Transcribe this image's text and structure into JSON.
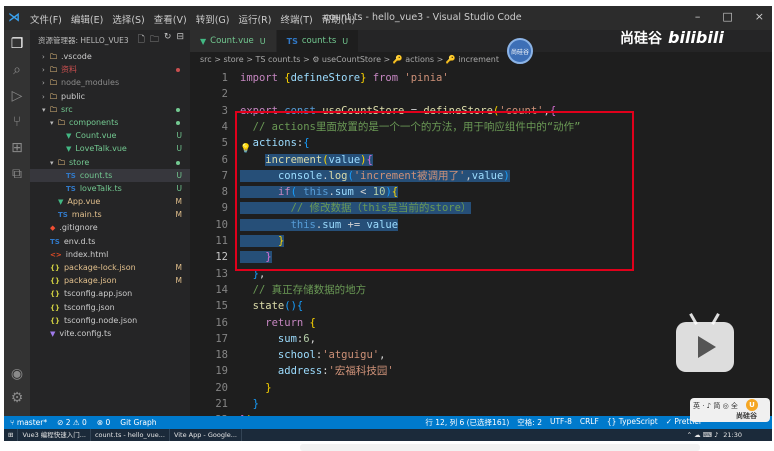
{
  "window": {
    "title": "count.ts - hello_vue3 - Visual Studio Code",
    "menus": [
      "文件(F)",
      "编辑(E)",
      "选择(S)",
      "查看(V)",
      "转到(G)",
      "运行(R)",
      "终端(T)",
      "帮助(H)"
    ],
    "controls": [
      "–",
      "□",
      "×"
    ]
  },
  "sidebar": {
    "header": "资源管理器: HELLO_VUE3",
    "items": [
      {
        "indent": 1,
        "chev": ">",
        "icon": "folder",
        "label": ".vscode",
        "color": "#cccccc",
        "mark": "",
        "dot": ""
      },
      {
        "indent": 1,
        "chev": ">",
        "icon": "folder",
        "label": "资料",
        "color": "#c94f4f",
        "mark": "",
        "dot": "#c94f4f"
      },
      {
        "indent": 1,
        "chev": ">",
        "icon": "folder",
        "label": "node_modules",
        "color": "#8b8b8b",
        "mark": "",
        "dot": ""
      },
      {
        "indent": 1,
        "chev": ">",
        "icon": "folder",
        "label": "public",
        "color": "#cccccc",
        "mark": "",
        "dot": ""
      },
      {
        "indent": 1,
        "chev": "v",
        "icon": "folder",
        "label": "src",
        "color": "#73c991",
        "mark": "",
        "dot": "#73c991"
      },
      {
        "indent": 2,
        "chev": "v",
        "icon": "folder",
        "label": "components",
        "color": "#73c991",
        "mark": "",
        "dot": "#73c991"
      },
      {
        "indent": 3,
        "chev": "",
        "icon": "vue",
        "label": "Count.vue",
        "color": "#73c991",
        "mark": "U",
        "dot": ""
      },
      {
        "indent": 3,
        "chev": "",
        "icon": "vue",
        "label": "LoveTalk.vue",
        "color": "#73c991",
        "mark": "U",
        "dot": ""
      },
      {
        "indent": 2,
        "chev": "v",
        "icon": "folder",
        "label": "store",
        "color": "#73c991",
        "mark": "",
        "dot": "#73c991"
      },
      {
        "indent": 3,
        "chev": "",
        "icon": "ts",
        "label": "count.ts",
        "color": "#73c991",
        "mark": "U",
        "dot": "",
        "selected": true
      },
      {
        "indent": 3,
        "chev": "",
        "icon": "ts",
        "label": "loveTalk.ts",
        "color": "#73c991",
        "mark": "U",
        "dot": ""
      },
      {
        "indent": 2,
        "chev": "",
        "icon": "vue",
        "label": "App.vue",
        "color": "#e2c08d",
        "mark": "M",
        "dot": ""
      },
      {
        "indent": 2,
        "chev": "",
        "icon": "ts",
        "label": "main.ts",
        "color": "#e2c08d",
        "mark": "M",
        "dot": ""
      },
      {
        "indent": 1,
        "chev": "",
        "icon": "git",
        "label": ".gitignore",
        "color": "#cccccc",
        "mark": "",
        "dot": ""
      },
      {
        "indent": 1,
        "chev": "",
        "icon": "ts",
        "label": "env.d.ts",
        "color": "#cccccc",
        "mark": "",
        "dot": ""
      },
      {
        "indent": 1,
        "chev": "",
        "icon": "html",
        "label": "index.html",
        "color": "#cccccc",
        "mark": "",
        "dot": ""
      },
      {
        "indent": 1,
        "chev": "",
        "icon": "json",
        "label": "package-lock.json",
        "color": "#e2c08d",
        "mark": "M",
        "dot": ""
      },
      {
        "indent": 1,
        "chev": "",
        "icon": "json",
        "label": "package.json",
        "color": "#e2c08d",
        "mark": "M",
        "dot": ""
      },
      {
        "indent": 1,
        "chev": "",
        "icon": "json",
        "label": "tsconfig.app.json",
        "color": "#cccccc",
        "mark": "",
        "dot": ""
      },
      {
        "indent": 1,
        "chev": "",
        "icon": "json",
        "label": "tsconfig.json",
        "color": "#cccccc",
        "mark": "",
        "dot": ""
      },
      {
        "indent": 1,
        "chev": "",
        "icon": "json",
        "label": "tsconfig.node.json",
        "color": "#cccccc",
        "mark": "",
        "dot": ""
      },
      {
        "indent": 1,
        "chev": "",
        "icon": "vite",
        "label": "vite.config.ts",
        "color": "#cccccc",
        "mark": "",
        "dot": ""
      }
    ]
  },
  "tabs": [
    {
      "label": "Count.vue",
      "icon": "vue",
      "mark": "U",
      "active": false
    },
    {
      "label": "count.ts",
      "icon": "ts",
      "mark": "U",
      "active": true
    }
  ],
  "breadcrumb": "src > store > TS count.ts > ⚙ useCountStore > 🔑 actions > 🔑 increment",
  "code": {
    "first_line": 1,
    "current_line": 12,
    "lines": [
      [
        [
          "kw2",
          "import "
        ],
        [
          "br",
          "{"
        ],
        [
          "var",
          "defineStore"
        ],
        [
          "br",
          "}"
        ],
        [
          "kw2",
          " from "
        ],
        [
          "str",
          "'pinia'"
        ]
      ],
      [],
      [
        [
          "kw2",
          "export "
        ],
        [
          "kw",
          "const "
        ],
        [
          "fn",
          "useCountStore"
        ],
        [
          "d",
          " = "
        ],
        [
          "fn",
          "defineStore"
        ],
        [
          "br",
          "("
        ],
        [
          "str",
          "'count'"
        ],
        [
          "d",
          ","
        ],
        [
          "br2",
          "{"
        ]
      ],
      [
        [
          "cm",
          "  // actions里面放置的是一个一个的方法，用于响应组件中的“动作”"
        ]
      ],
      [
        [
          "var",
          "  actions"
        ],
        [
          "d",
          ":"
        ],
        [
          "br3",
          "{"
        ]
      ],
      [
        [
          "d",
          "    "
        ],
        [
          "fn",
          "increment",
          "hl"
        ],
        [
          "br",
          "(",
          "hl"
        ],
        [
          "var",
          "value",
          "hl"
        ],
        [
          "br",
          ")",
          "hl"
        ],
        [
          "br2",
          "{",
          "hl"
        ]
      ],
      [
        [
          "d",
          "      ",
          "hl"
        ],
        [
          "var",
          "console",
          "hl"
        ],
        [
          "d",
          ".",
          "hl"
        ],
        [
          "fn",
          "log",
          "hl"
        ],
        [
          "br3",
          "(",
          "hl"
        ],
        [
          "str",
          "'increment被调用了'",
          "hl"
        ],
        [
          "d",
          ",",
          "hl"
        ],
        [
          "var",
          "value",
          "hl"
        ],
        [
          "br3",
          ")",
          "hl"
        ]
      ],
      [
        [
          "d",
          "      ",
          "hl"
        ],
        [
          "kw2",
          "if",
          "hl"
        ],
        [
          "br3",
          "(",
          "hl"
        ],
        [
          "kw",
          " this",
          "hl"
        ],
        [
          "d",
          ".",
          "hl"
        ],
        [
          "var",
          "sum",
          "hl"
        ],
        [
          "d",
          " < ",
          "hl"
        ],
        [
          "num",
          "10",
          "hl"
        ],
        [
          "br3",
          ")",
          "hl"
        ],
        [
          "br",
          "{",
          "hl"
        ]
      ],
      [
        [
          "d",
          "        ",
          "hl"
        ],
        [
          "cm",
          "// 修改数据（this是当前的store）",
          "hl"
        ]
      ],
      [
        [
          "d",
          "        ",
          "hl"
        ],
        [
          "kw",
          "this",
          "hl"
        ],
        [
          "d",
          ".",
          "hl"
        ],
        [
          "var",
          "sum",
          "hl"
        ],
        [
          "d",
          " += ",
          "hl"
        ],
        [
          "var",
          "value",
          "hl"
        ]
      ],
      [
        [
          "d",
          "      ",
          "hl"
        ],
        [
          "br",
          "}",
          "hl"
        ]
      ],
      [
        [
          "d",
          "    ",
          "hl"
        ],
        [
          "br2",
          "}",
          "hl"
        ]
      ],
      [
        [
          "br3",
          "  }"
        ],
        [
          "d",
          ","
        ]
      ],
      [
        [
          "cm",
          "  // 真正存储数据的地方"
        ]
      ],
      [
        [
          "fn",
          "  state"
        ],
        [
          "br3",
          "()"
        ],
        [
          "br3",
          "{"
        ]
      ],
      [
        [
          "kw2",
          "    return "
        ],
        [
          "br",
          "{"
        ]
      ],
      [
        [
          "var",
          "      sum"
        ],
        [
          "d",
          ":"
        ],
        [
          "num",
          "6"
        ],
        [
          "d",
          ","
        ]
      ],
      [
        [
          "var",
          "      school"
        ],
        [
          "d",
          ":"
        ],
        [
          "str",
          "'atguigu'"
        ],
        [
          "d",
          ","
        ]
      ],
      [
        [
          "var",
          "      address"
        ],
        [
          "d",
          ":"
        ],
        [
          "str",
          "'宏福科技园'"
        ]
      ],
      [
        [
          "br",
          "    }"
        ]
      ],
      [
        [
          "br3",
          "  }"
        ]
      ],
      [
        [
          "br2",
          "}"
        ],
        [
          "br",
          ")"
        ]
      ]
    ]
  },
  "status": {
    "left": [
      "⑂ master*",
      "⊘ 2 ⚠ 0",
      "⊗ 0",
      "Git Graph"
    ],
    "right": [
      "行 12, 列 6 (已选择161)",
      "空格: 2",
      "UTF-8",
      "CRLF",
      "{} TypeScript",
      "✓ Prettier"
    ]
  },
  "taskbar": {
    "items": [
      "Vue3 编程快速入门...",
      "count.ts - hello_vue...",
      "Vite App - Google..."
    ],
    "time": "21:30"
  },
  "overlay": {
    "watermark": "尚硅谷",
    "bili": "bilibili",
    "avatar": "尚硅谷",
    "brand_top": "英 · ♪ 简 ◎ 全",
    "brand_name": "尚硅谷",
    "brand_u": "U"
  },
  "colors": {
    "accent": "#007acc",
    "highlight_box": "#e0001b",
    "selection": "#264f78"
  }
}
